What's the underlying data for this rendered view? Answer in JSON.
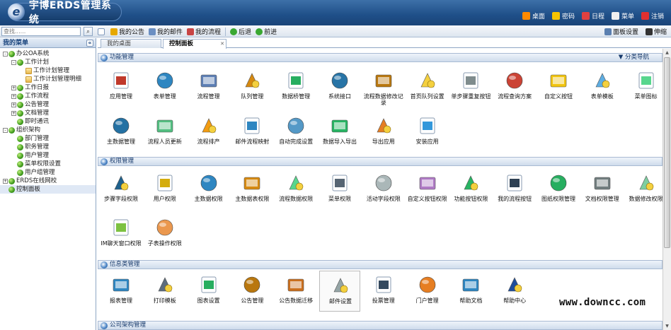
{
  "app": {
    "title": "宇博ERDS管理系统"
  },
  "topnav": [
    {
      "label": "桌面",
      "icon": "home-icon",
      "color": "#ff8a00"
    },
    {
      "label": "密码",
      "icon": "key-icon",
      "color": "#f5c400"
    },
    {
      "label": "日程",
      "icon": "calendar-icon",
      "color": "#e04040"
    },
    {
      "label": "菜单",
      "icon": "menu-icon",
      "color": "#f0f0f0"
    },
    {
      "label": "注销",
      "icon": "logout-icon",
      "color": "#e03030"
    }
  ],
  "search": {
    "placeholder": "查找......"
  },
  "toolbar": {
    "items": [
      {
        "label": "我的公告",
        "icon": "announcement-icon",
        "color": "#e6a800"
      },
      {
        "label": "我的邮件",
        "icon": "mail-icon",
        "color": "#6b8fc2"
      },
      {
        "label": "我的流程",
        "icon": "flow-icon",
        "color": "#c84545"
      },
      {
        "label": "后退",
        "icon": "back-icon",
        "color": "#3aa832"
      },
      {
        "label": "前进",
        "icon": "forward-icon",
        "color": "#3aa832"
      }
    ],
    "right": [
      {
        "label": "面板设置",
        "icon": "panel-settings-icon",
        "color": "#5a7fb0"
      },
      {
        "label": "伸缩",
        "icon": "expand-icon",
        "color": "#333333"
      }
    ]
  },
  "sidebar": {
    "title": "我的菜单",
    "items": [
      {
        "label": "办公OA系统",
        "level": 0,
        "toggle": "-",
        "leaf": false
      },
      {
        "label": "工作计划",
        "level": 1,
        "toggle": "-",
        "leaf": false
      },
      {
        "label": "工作计划管理",
        "level": 2,
        "toggle": "",
        "leaf": true
      },
      {
        "label": "工作计划管理明细",
        "level": 2,
        "toggle": "",
        "leaf": true
      },
      {
        "label": "工作日报",
        "level": 1,
        "toggle": "+",
        "leaf": false
      },
      {
        "label": "工作流程",
        "level": 1,
        "toggle": "+",
        "leaf": false
      },
      {
        "label": "公告管理",
        "level": 1,
        "toggle": "+",
        "leaf": false
      },
      {
        "label": "文档管理",
        "level": 1,
        "toggle": "+",
        "leaf": false
      },
      {
        "label": "即时通讯",
        "level": 1,
        "toggle": "",
        "leaf": false
      },
      {
        "label": "组织架构",
        "level": 0,
        "toggle": "-",
        "leaf": false
      },
      {
        "label": "部门管理",
        "level": 1,
        "toggle": "",
        "leaf": false
      },
      {
        "label": "职务管理",
        "level": 1,
        "toggle": "",
        "leaf": false
      },
      {
        "label": "用户管理",
        "level": 1,
        "toggle": "",
        "leaf": false
      },
      {
        "label": "菜单权限设置",
        "level": 1,
        "toggle": "",
        "leaf": false
      },
      {
        "label": "用户组管理",
        "level": 1,
        "toggle": "",
        "leaf": false
      },
      {
        "label": "ERDS在线网校",
        "level": 0,
        "toggle": "+",
        "leaf": false
      },
      {
        "label": "控制面板",
        "level": 0,
        "toggle": "",
        "leaf": false,
        "selected": true
      }
    ]
  },
  "tabs": [
    {
      "label": "我的桌面",
      "active": false
    },
    {
      "label": "控制面板",
      "active": true
    }
  ],
  "sections": [
    {
      "title": "功能管理",
      "right": "▼ 分类导航",
      "items": [
        {
          "label": "应用管理",
          "icon": "app-management-icon",
          "color": "#c0392b"
        },
        {
          "label": "表单管理",
          "icon": "form-management-icon",
          "color": "#2e86c1"
        },
        {
          "label": "流程管理",
          "icon": "flow-management-icon",
          "color": "#5d7fb5"
        },
        {
          "label": "队列管理",
          "icon": "queue-management-icon",
          "color": "#d68910"
        },
        {
          "label": "数据桥管理",
          "icon": "data-bridge-icon",
          "color": "#27ae60"
        },
        {
          "label": "系统接口",
          "icon": "usb-interface-icon",
          "color": "#2874a6"
        },
        {
          "label": "流程数据修改记录",
          "icon": "data-edit-log-icon",
          "color": "#b9770e"
        },
        {
          "label": "首页队列设置",
          "icon": "home-queue-icon",
          "color": "#f4d03f"
        },
        {
          "label": "单步骤重复按钮",
          "icon": "step-repeat-icon",
          "color": "#7f8c8d"
        },
        {
          "label": "流程查询方案",
          "icon": "flow-query-icon",
          "color": "#cb4335"
        },
        {
          "label": "自定义按钮",
          "icon": "custom-button-icon",
          "color": "#f1c40f"
        },
        {
          "label": "表单模板",
          "icon": "form-template-icon",
          "color": "#5dade2"
        },
        {
          "label": "菜单图标",
          "icon": "menu-icon-set-icon",
          "color": "#58d68d"
        },
        {
          "label": "主数据管理",
          "icon": "master-data-icon",
          "color": "#2471a3"
        },
        {
          "label": "流程人员更新",
          "icon": "flow-user-update-icon",
          "color": "#52be80"
        },
        {
          "label": "流程排产",
          "icon": "gears-icon",
          "color": "#f39c12"
        },
        {
          "label": "邮件流程映射",
          "icon": "mail-flow-map-icon",
          "color": "#2e86c1"
        },
        {
          "label": "自动完成设置",
          "icon": "auto-complete-icon",
          "color": "#5499c7"
        },
        {
          "label": "数据导入导出",
          "icon": "import-export-icon",
          "color": "#28b463"
        },
        {
          "label": "导出应用",
          "icon": "export-app-icon",
          "color": "#e67e22"
        },
        {
          "label": "安装应用",
          "icon": "install-app-icon",
          "color": "#3498db"
        }
      ]
    },
    {
      "title": "权限管理",
      "right": "",
      "items": [
        {
          "label": "步骤字段权限",
          "icon": "step-field-perm-icon",
          "color": "#1f618d"
        },
        {
          "label": "用户权限",
          "icon": "user-lock-icon",
          "color": "#d4ac0d"
        },
        {
          "label": "主数据权限",
          "icon": "master-data-perm-icon",
          "color": "#2e86c1"
        },
        {
          "label": "主数据表权限",
          "icon": "master-table-perm-icon",
          "color": "#d68910"
        },
        {
          "label": "流程数据权限",
          "icon": "flow-data-perm-icon",
          "color": "#58d68d"
        },
        {
          "label": "菜单权限",
          "icon": "menu-perm-icon",
          "color": "#566573"
        },
        {
          "label": "活动字段权限",
          "icon": "activity-field-perm-icon",
          "color": "#aab7b8"
        },
        {
          "label": "自定义按钮权限",
          "icon": "custom-button-perm-icon",
          "color": "#af7ac5"
        },
        {
          "label": "功能按钮权限",
          "icon": "check-perm-icon",
          "color": "#28b463"
        },
        {
          "label": "我的流程按钮",
          "icon": "my-flow-button-icon",
          "color": "#2e4053"
        },
        {
          "label": "图纸权限管理",
          "icon": "drawing-perm-icon",
          "color": "#27ae60"
        },
        {
          "label": "文档权限管理",
          "icon": "document-perm-icon",
          "color": "#717d7e"
        },
        {
          "label": "数据修改权限",
          "icon": "data-edit-perm-icon",
          "color": "#7dcea0"
        },
        {
          "label": "IM聊天窗口权限",
          "icon": "im-chat-icon",
          "color": "#7dc242"
        },
        {
          "label": "子表操作权限",
          "icon": "subtable-edit-icon",
          "color": "#eb984e"
        }
      ]
    },
    {
      "title": "信息类管理",
      "right": "",
      "items": [
        {
          "label": "报表管理",
          "icon": "report-chart-icon",
          "color": "#2e86c1"
        },
        {
          "label": "打印模板",
          "icon": "printer-icon",
          "color": "#5d6d7e"
        },
        {
          "label": "图表设置",
          "icon": "chart-settings-icon",
          "color": "#27ae60"
        },
        {
          "label": "公告管理",
          "icon": "announcement-user-icon",
          "color": "#b9770e"
        },
        {
          "label": "公告数据迁移",
          "icon": "clipboard-icon",
          "color": "#ca6f1e"
        },
        {
          "label": "邮件设置",
          "icon": "mail-settings-icon",
          "color": "#95a5a6"
        },
        {
          "label": "投票管理",
          "icon": "vote-chart-icon",
          "color": "#34495e"
        },
        {
          "label": "门户管理",
          "icon": "portal-house-icon",
          "color": "#e67e22"
        },
        {
          "label": "帮助文档",
          "icon": "help-doc-icon",
          "color": "#2e86c1"
        },
        {
          "label": "帮助中心",
          "icon": "word-doc-icon",
          "color": "#1f4e9c"
        }
      ]
    },
    {
      "title": "公司架构管理",
      "right": "",
      "items": []
    }
  ],
  "watermark": "www.downcc.com"
}
